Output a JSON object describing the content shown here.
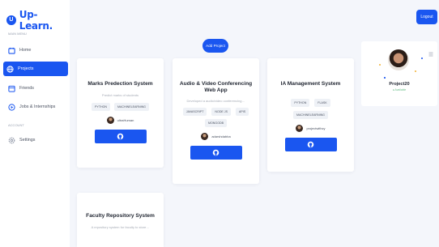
{
  "brand": {
    "name": "Up-Learn.",
    "accent": "#1a56f0"
  },
  "sidebar": {
    "section_main": "MAIN MENU",
    "section_account": "ACCOUNT",
    "items": [
      {
        "label": "Home",
        "icon": "home-icon"
      },
      {
        "label": "Projects",
        "icon": "globe-icon",
        "active": true
      },
      {
        "label": "Friends",
        "icon": "calendar-icon"
      },
      {
        "label": "Jobs & Internships",
        "icon": "play-circle-icon"
      },
      {
        "label": "Settings",
        "icon": "gear-icon"
      }
    ]
  },
  "header": {
    "logout_label": "Logout"
  },
  "main": {
    "add_project_label": "Add Project"
  },
  "projects": [
    {
      "title": "Marks Predection System",
      "description": "Predict marks of students",
      "tags": [
        "PYTHON",
        "MACHINELEARNING"
      ],
      "author": "ultraHuman"
    },
    {
      "title": "Audio & Video Conferencing Web App",
      "description": "Developed a audio/video conferencing…",
      "tags": [
        "JAVASCRIPT",
        "NODE JS",
        "APIS",
        "MONGODB"
      ],
      "author": "adarshdabba"
    },
    {
      "title": "IA Management System",
      "description": "",
      "tags": [
        "PYTHON",
        "FLASK",
        "MACHINELEARNING"
      ],
      "author": "projectwithcy"
    },
    {
      "title": "Faculty Repository System",
      "description": "A repository system for faculty to store…"
    }
  ],
  "profile": {
    "name": "Project20",
    "status": "● Available"
  }
}
